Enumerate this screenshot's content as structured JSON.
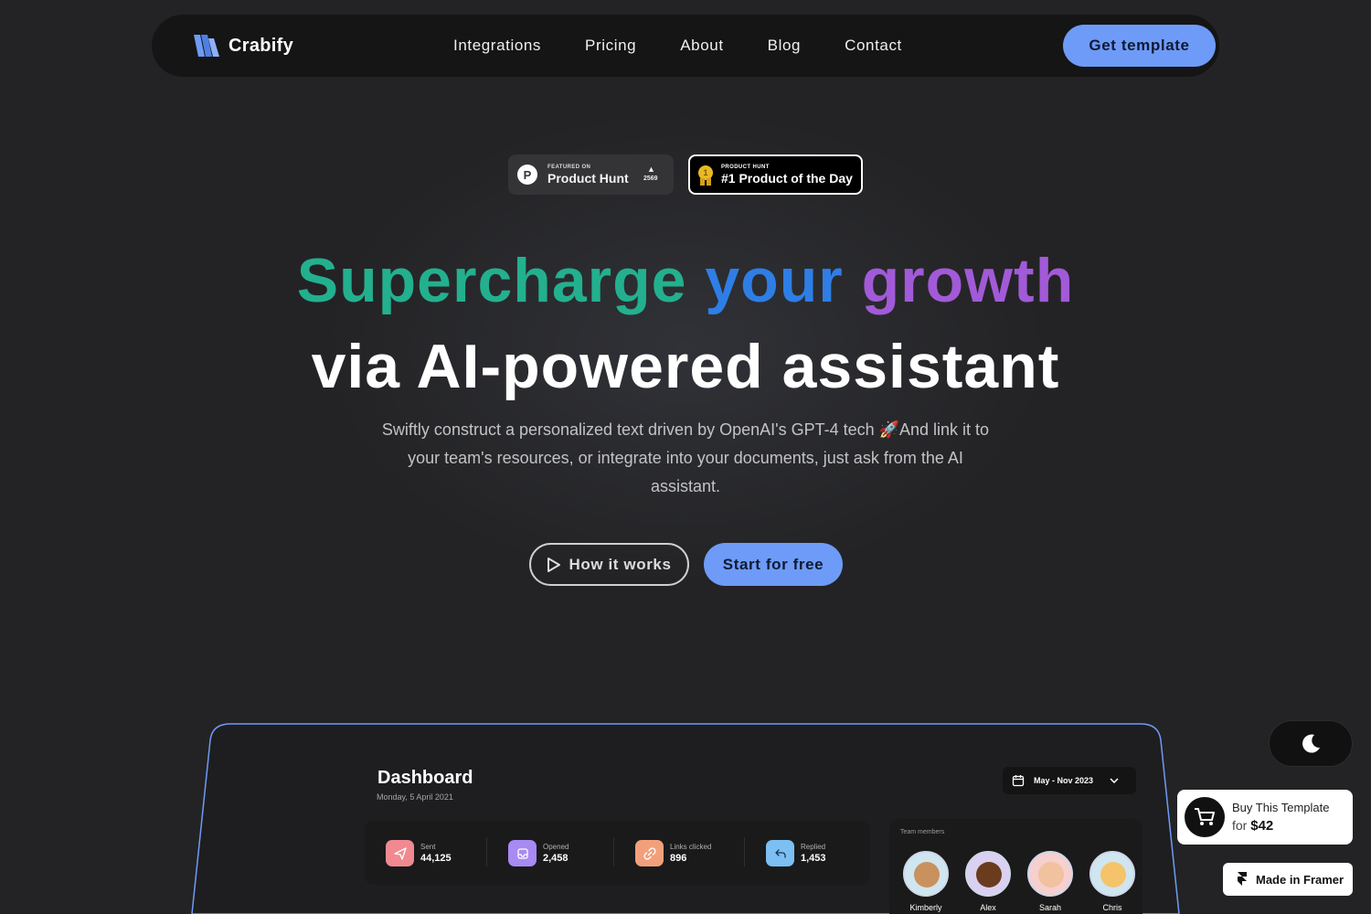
{
  "brand": {
    "name": "Crabify"
  },
  "nav": {
    "links": [
      "Integrations",
      "Pricing",
      "About",
      "Blog",
      "Contact"
    ],
    "cta": "Get template"
  },
  "badges": {
    "product_hunt": {
      "small": "FEATURED ON",
      "title": "Product Hunt",
      "votes": "2569"
    },
    "product_of_day": {
      "small": "PRODUCT HUNT",
      "title": "#1 Product of the Day"
    }
  },
  "hero": {
    "headline_1": "Supercharge",
    "headline_2": "your",
    "headline_3": "growth",
    "headline_line2": "via AI-powered assistant",
    "subtitle": "Swiftly construct a personalized text driven by OpenAI's GPT-4 tech 🚀And link it to your team's resources, or integrate into your documents, just ask from the AI assistant.",
    "btn_how": "How it works",
    "btn_start": "Start for free"
  },
  "dashboard": {
    "title": "Dashboard",
    "date": "Monday, 5 April 2021",
    "date_range": "May - Nov 2023",
    "stats": [
      {
        "label": "Sent",
        "value": "44,125",
        "icon": "send-icon",
        "color": "#f08a90"
      },
      {
        "label": "Opened",
        "value": "2,458",
        "icon": "inbox-icon",
        "color": "#a78af2"
      },
      {
        "label": "Links clicked",
        "value": "896",
        "icon": "link-icon",
        "color": "#f2a07c"
      },
      {
        "label": "Replied",
        "value": "1,453",
        "icon": "reply-icon",
        "color": "#7cbff2"
      }
    ],
    "team": {
      "title": "Team members",
      "members": [
        {
          "name": "Kimberly",
          "bg": "#cfe6f0",
          "face": "#c9915e"
        },
        {
          "name": "Alex",
          "bg": "#d9d0f2",
          "face": "#6b3b1e"
        },
        {
          "name": "Sarah",
          "bg": "#f6cfcf",
          "face": "#f1c1a0"
        },
        {
          "name": "Chris",
          "bg": "#cfe6f0",
          "face": "#f5c36a"
        }
      ]
    }
  },
  "floating": {
    "buy_line1": "Buy This Template",
    "buy_for": "for",
    "buy_price": "$42",
    "framer": "Made in Framer"
  },
  "colors": {
    "accent": "#6e9bf7",
    "background": "#232325",
    "nav_bg": "#151516"
  }
}
